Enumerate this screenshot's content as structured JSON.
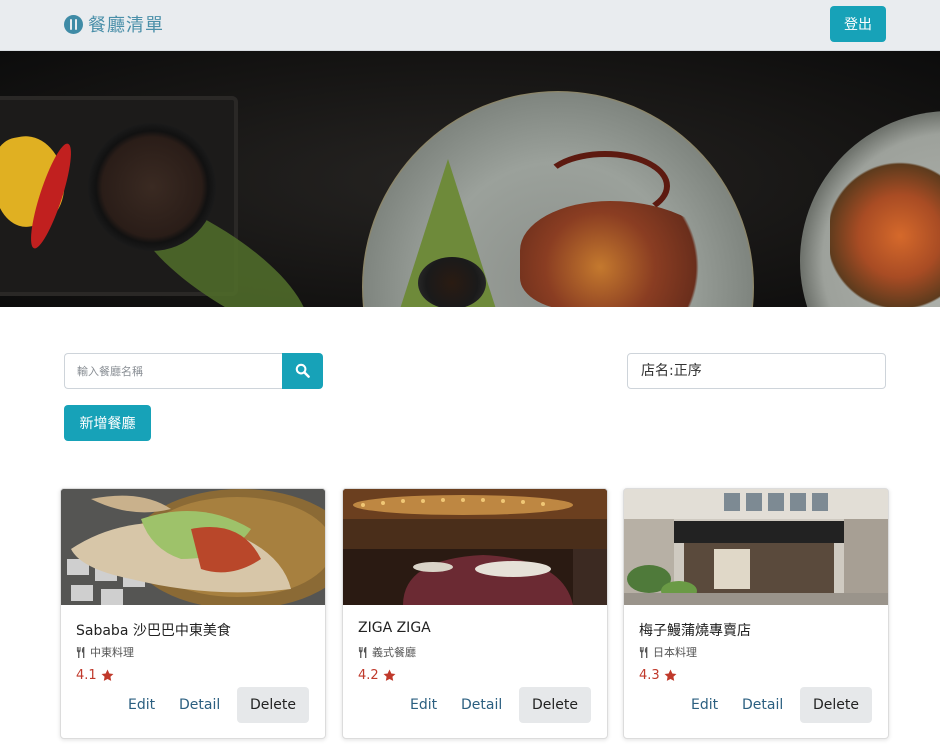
{
  "navbar": {
    "brand": "餐廳清單",
    "brand_icon": "utensils-circle-icon",
    "logout_label": "登出"
  },
  "banner": {
    "alt": "food banner"
  },
  "search": {
    "placeholder": "輸入餐廳名稱",
    "value": "",
    "button_icon": "search-icon"
  },
  "sort": {
    "selected": "店名:正序"
  },
  "actions": {
    "add_label": "新增餐廳"
  },
  "restaurants": [
    {
      "name": "Sababa 沙巴巴中東美食",
      "category": "中東料理",
      "rating": "4.1",
      "edit": "Edit",
      "detail": "Detail",
      "delete": "Delete"
    },
    {
      "name": "ZIGA ZIGA",
      "category": "義式餐廳",
      "rating": "4.2",
      "edit": "Edit",
      "detail": "Detail",
      "delete": "Delete"
    },
    {
      "name": "梅子鰻蒲燒專賣店",
      "category": "日本料理",
      "rating": "4.3",
      "edit": "Edit",
      "detail": "Detail",
      "delete": "Delete"
    }
  ],
  "colors": {
    "accent": "#17a2b8",
    "navbar_bg": "#e9ecef",
    "rating": "#c0392b",
    "link": "#2b5f80"
  }
}
